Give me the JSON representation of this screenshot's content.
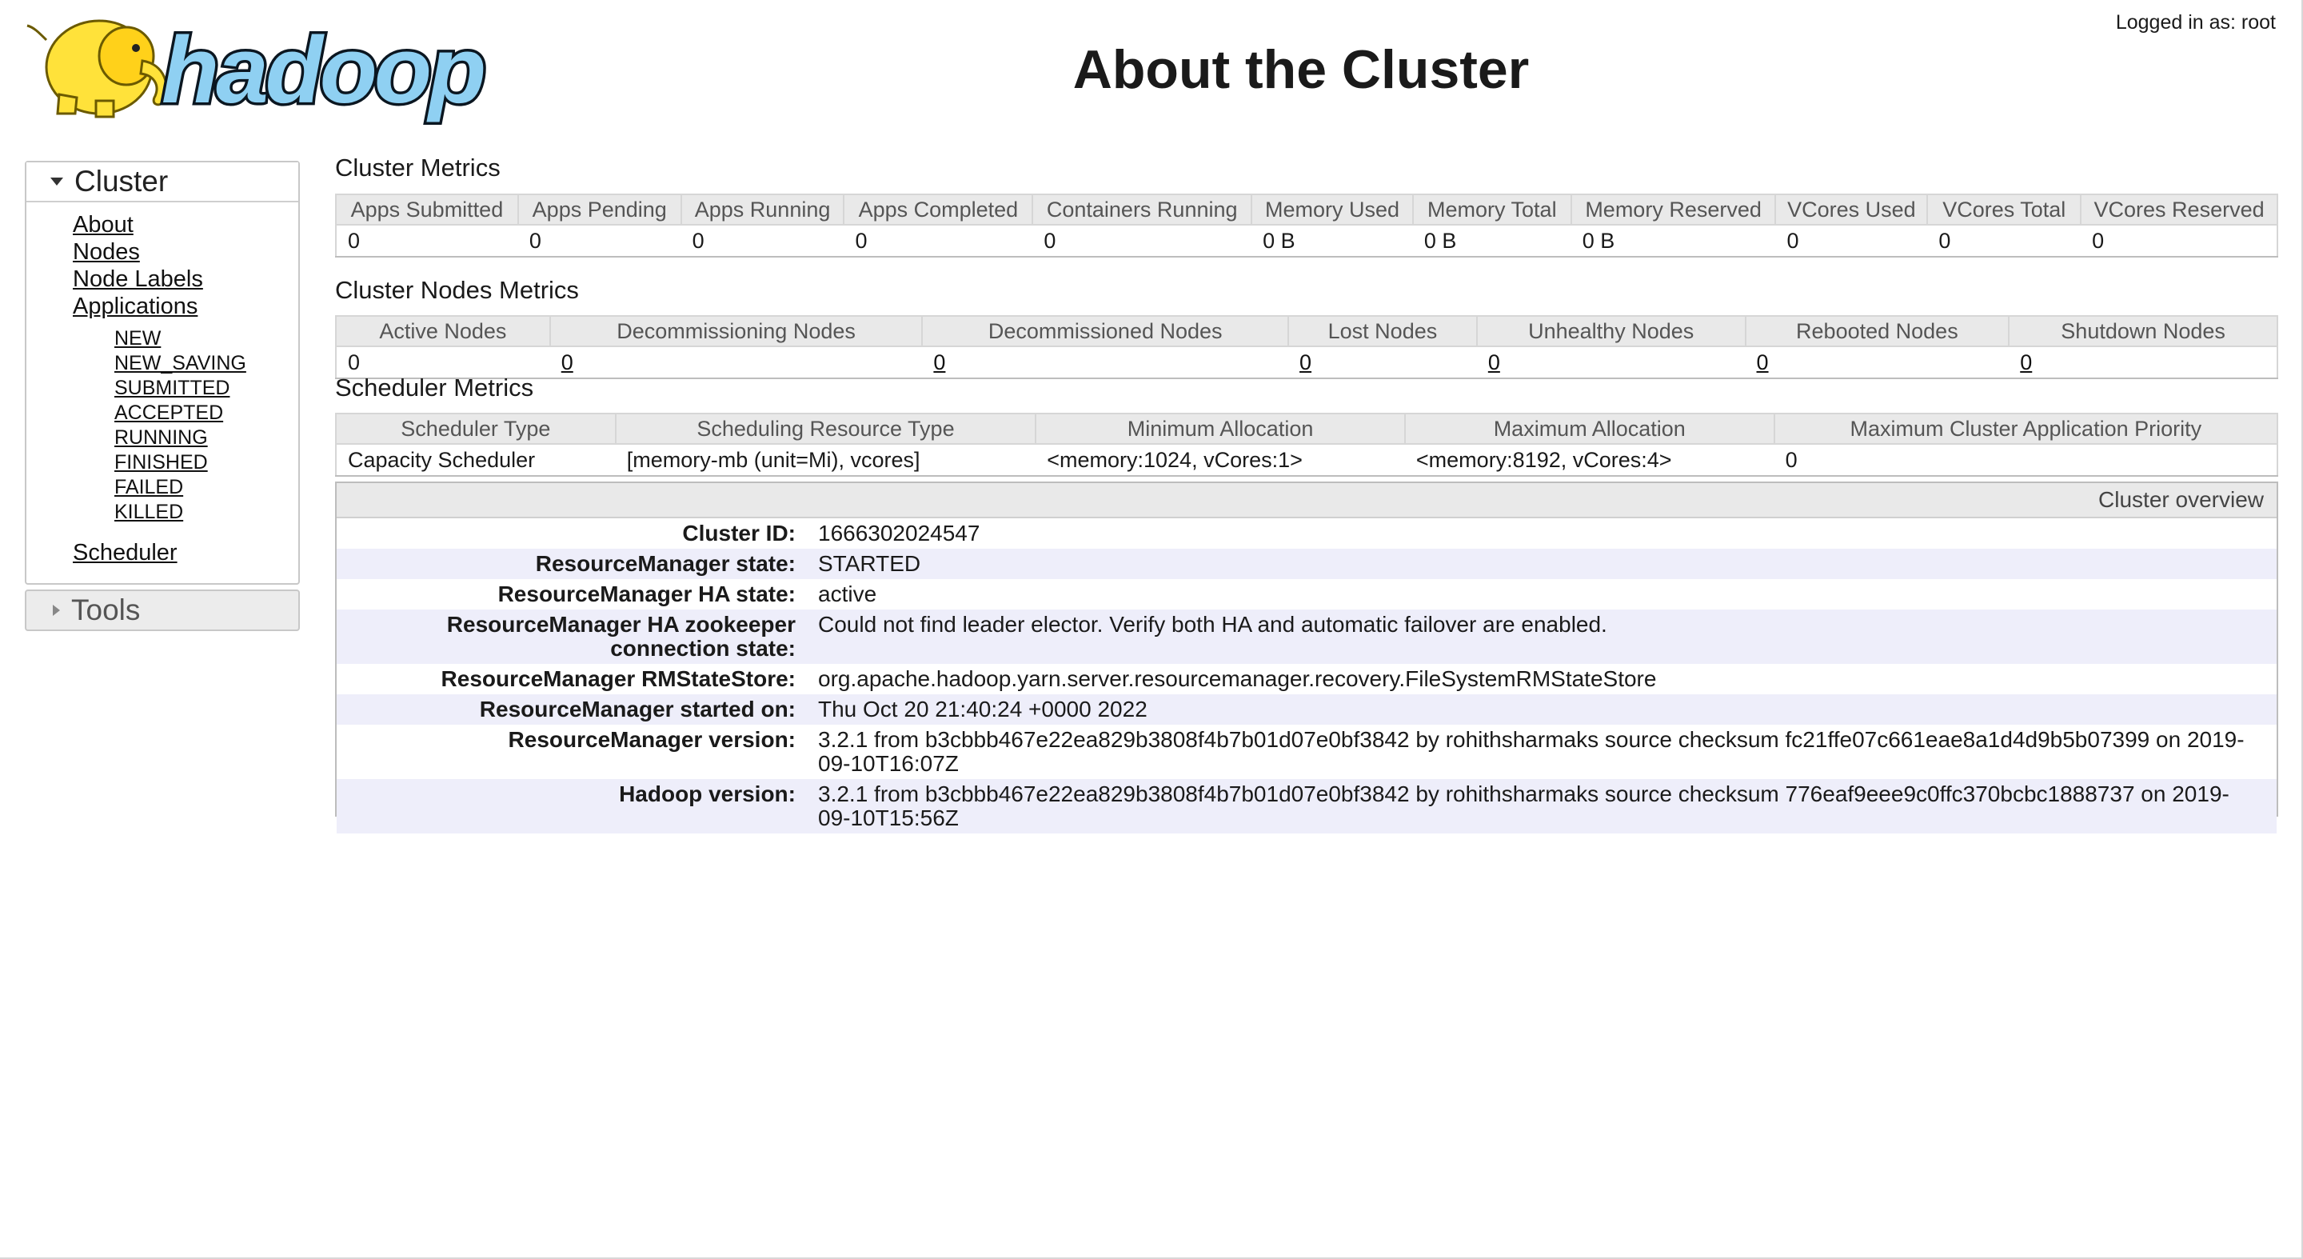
{
  "header": {
    "logo_text": "hadoop",
    "title": "About the Cluster",
    "login_text": "Logged in as: root"
  },
  "sidebar": {
    "cluster_label": "Cluster",
    "tools_label": "Tools",
    "items": [
      {
        "label": "About"
      },
      {
        "label": "Nodes"
      },
      {
        "label": "Node Labels"
      },
      {
        "label": "Applications"
      }
    ],
    "app_states": [
      "NEW",
      "NEW_SAVING",
      "SUBMITTED",
      "ACCEPTED",
      "RUNNING",
      "FINISHED",
      "FAILED",
      "KILLED"
    ],
    "scheduler_label": "Scheduler"
  },
  "cluster_metrics": {
    "title": "Cluster Metrics",
    "headers": [
      "Apps Submitted",
      "Apps Pending",
      "Apps Running",
      "Apps Completed",
      "Containers Running",
      "Memory Used",
      "Memory Total",
      "Memory Reserved",
      "VCores Used",
      "VCores Total",
      "VCores Reserved"
    ],
    "values": [
      "0",
      "0",
      "0",
      "0",
      "0",
      "0 B",
      "0 B",
      "0 B",
      "0",
      "0",
      "0"
    ]
  },
  "node_metrics": {
    "title": "Cluster Nodes Metrics",
    "headers": [
      "Active Nodes",
      "Decommissioning Nodes",
      "Decommissioned Nodes",
      "Lost Nodes",
      "Unhealthy Nodes",
      "Rebooted Nodes",
      "Shutdown Nodes"
    ],
    "values": [
      "0",
      "0",
      "0",
      "0",
      "0",
      "0",
      "0"
    ]
  },
  "scheduler_metrics": {
    "title": "Scheduler Metrics",
    "headers": [
      "Scheduler Type",
      "Scheduling Resource Type",
      "Minimum Allocation",
      "Maximum Allocation",
      "Maximum Cluster Application Priority"
    ],
    "values": [
      "Capacity Scheduler",
      "[memory-mb (unit=Mi), vcores]",
      "<memory:1024, vCores:1>",
      "<memory:8192, vCores:4>",
      "0"
    ]
  },
  "overview": {
    "title": "Cluster overview",
    "rows": [
      {
        "label": "Cluster ID:",
        "value": "1666302024547"
      },
      {
        "label": "ResourceManager state:",
        "value": "STARTED"
      },
      {
        "label": "ResourceManager HA state:",
        "value": "active"
      },
      {
        "label": "ResourceManager HA zookeeper connection state:",
        "value": "Could not find leader elector. Verify both HA and automatic failover are enabled."
      },
      {
        "label": "ResourceManager RMStateStore:",
        "value": "org.apache.hadoop.yarn.server.resourcemanager.recovery.FileSystemRMStateStore"
      },
      {
        "label": "ResourceManager started on:",
        "value": "Thu Oct 20 21:40:24 +0000 2022"
      },
      {
        "label": "ResourceManager version:",
        "value": "3.2.1 from b3cbbb467e22ea829b3808f4b7b01d07e0bf3842 by rohithsharmaks source checksum fc21ffe07c661eae8a1d4d9b5b07399 on 2019-09-10T16:07Z"
      },
      {
        "label": "Hadoop version:",
        "value": "3.2.1 from b3cbbb467e22ea829b3808f4b7b01d07e0bf3842 by rohithsharmaks source checksum 776eaf9eee9c0ffc370bcbc1888737 on 2019-09-10T15:56Z"
      }
    ]
  }
}
